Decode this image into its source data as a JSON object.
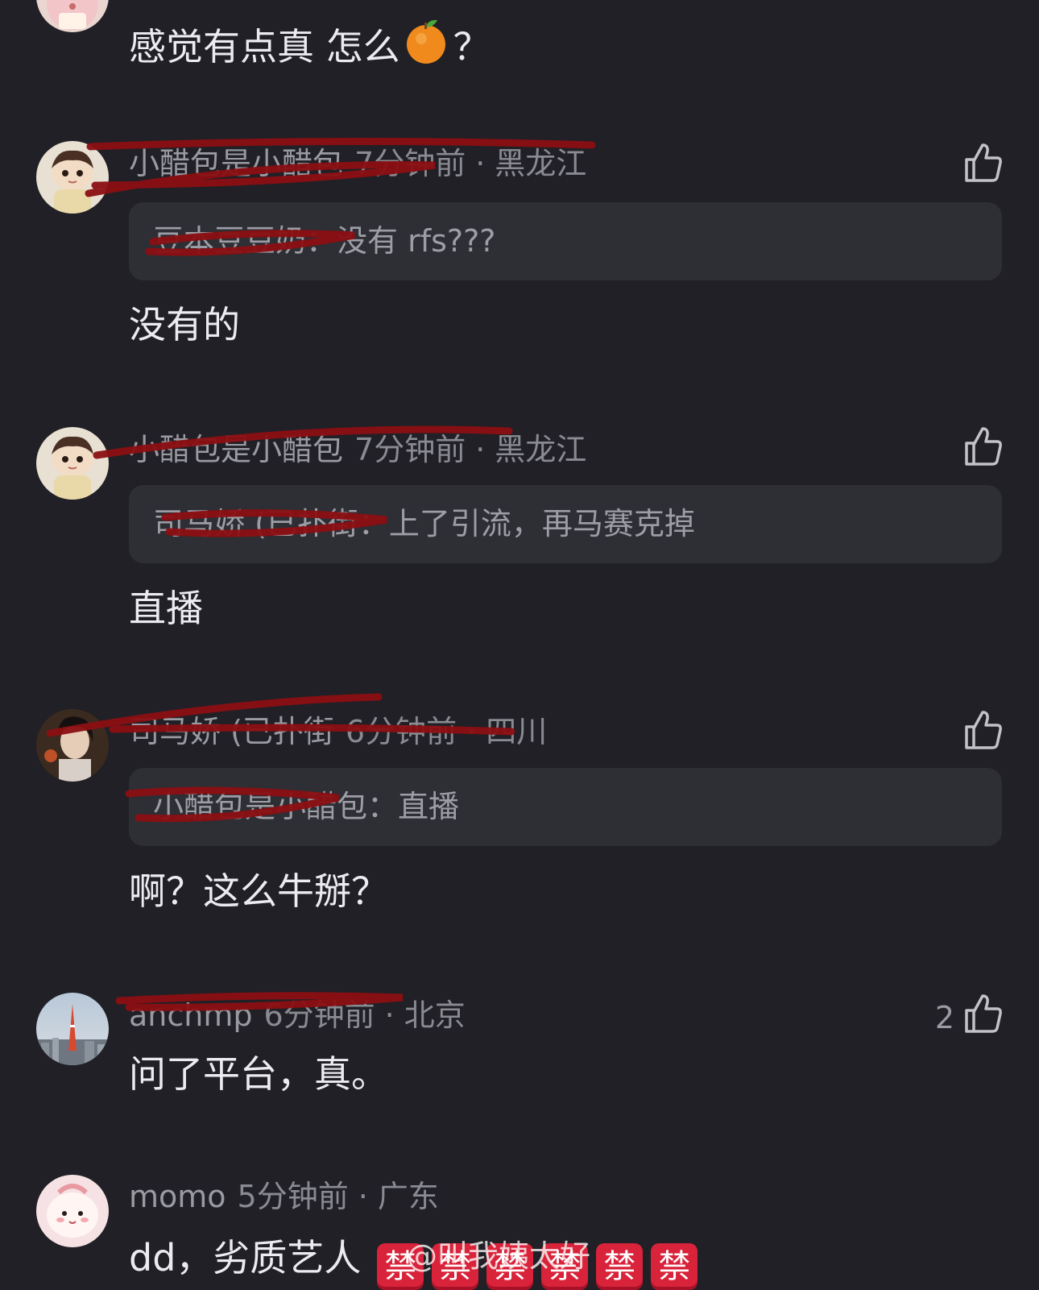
{
  "comments": [
    {
      "body": "感觉有点真 怎么",
      "body_suffix": "？"
    },
    {
      "username": "小醋包是小醋包",
      "time": "7分钟前",
      "location": "黑龙江",
      "quote_user": "豆本豆豆奶",
      "quote_text": "没有 rfs???",
      "body": "没有的"
    },
    {
      "username": "小醋包是小醋包",
      "time": "7分钟前",
      "location": "黑龙江",
      "quote_user": "司马娇 (已扑街",
      "quote_text": "上了引流，再马赛克掉",
      "body": "直播"
    },
    {
      "username": "司马娇 (已扑街",
      "time": "6分钟前",
      "location": "四川",
      "quote_user": "小醋包是小醋包",
      "quote_text": "直播",
      "body": "啊？这么牛掰？"
    },
    {
      "username": "anchmp",
      "time": "6分钟前",
      "location": "北京",
      "likes": "2",
      "body": "问了平台，真。"
    },
    {
      "username": "momo",
      "time": "5分钟前",
      "location": "广东",
      "body": "dd，劣质艺人",
      "emoji_ban": "禁"
    }
  ],
  "separator": "·",
  "quote_colon": "：",
  "watermark": "@叫我姨太好",
  "icons": {
    "like": "thumbs-up-icon",
    "orange": "tangerine-emoji-icon",
    "ban": "forbidden-ban-emoji"
  },
  "colors": {
    "background": "#202026",
    "quote_bg": "#2e2e35",
    "redaction": "#8b0f12",
    "ban_red": "#d8233a"
  }
}
